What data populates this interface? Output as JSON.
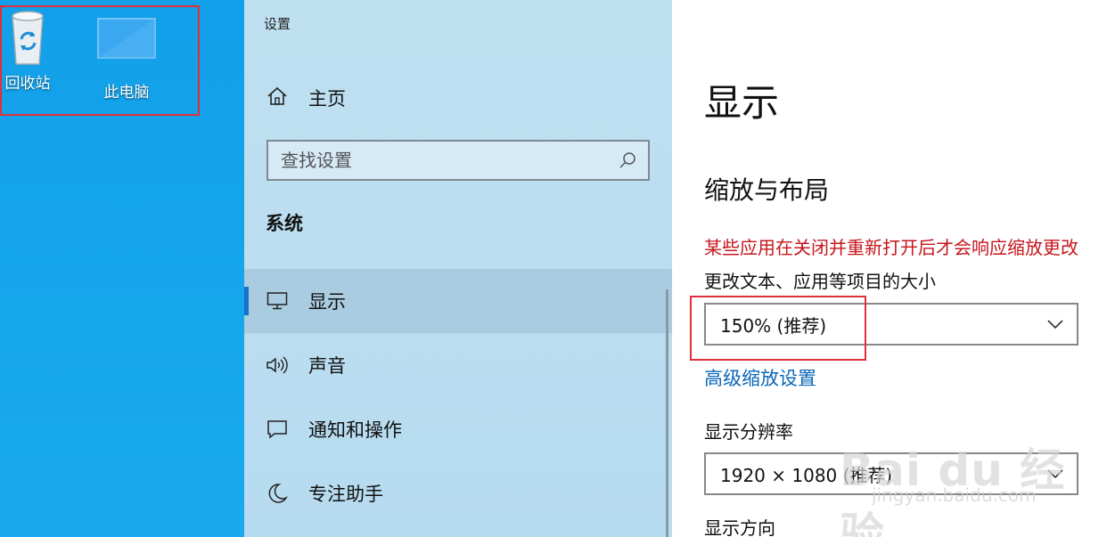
{
  "desktop": {
    "icons": [
      {
        "label": "回收站",
        "icon": "recycle-bin-icon"
      },
      {
        "label": "此电脑",
        "icon": "this-pc-icon"
      }
    ]
  },
  "window": {
    "title": "设置"
  },
  "nav": {
    "home_label": "主页",
    "search_placeholder": "查找设置",
    "section_title": "系统",
    "items": [
      {
        "label": "显示",
        "icon": "monitor-icon",
        "selected": true
      },
      {
        "label": "声音",
        "icon": "speaker-icon",
        "selected": false
      },
      {
        "label": "通知和操作",
        "icon": "notification-icon",
        "selected": false
      },
      {
        "label": "专注助手",
        "icon": "moon-icon",
        "selected": false
      }
    ]
  },
  "content": {
    "page_title": "显示",
    "section_title": "缩放与布局",
    "warning_text": "某些应用在关闭并重新打开后才会响应缩放更改",
    "scale_label": "更改文本、应用等项目的大小",
    "scale_value": "150% (推荐)",
    "advanced_link": "高级缩放设置",
    "resolution_label": "显示分辨率",
    "resolution_value": "1920 × 1080 (推荐)",
    "orientation_label": "显示方向"
  },
  "watermark": {
    "logo_text": "Bai du 经验",
    "url": "jingyan.baidu.com"
  },
  "colors": {
    "accent": "#1672c8",
    "link": "#0a67b8",
    "warning": "#c4161c",
    "highlight": "#e0303a",
    "desktop": "#12a0ea"
  }
}
